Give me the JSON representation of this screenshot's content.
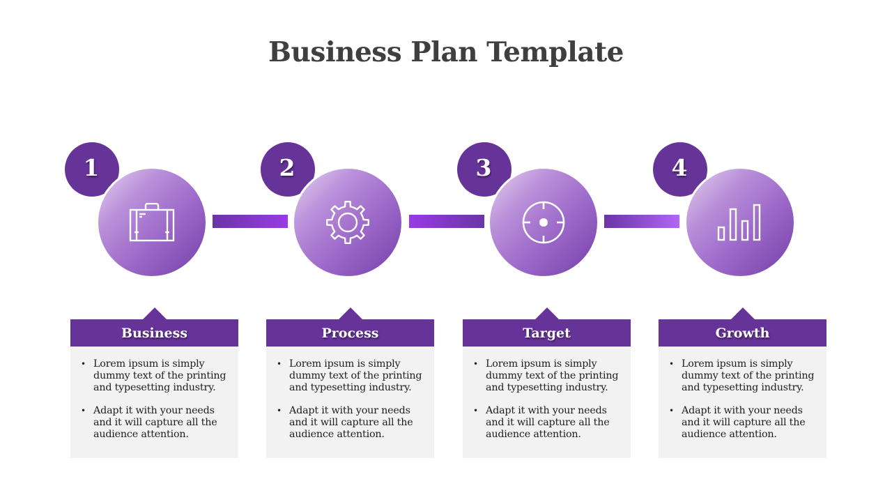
{
  "title": "Business Plan Template",
  "colors": {
    "primary": "#663399",
    "card_bg": "#f2f2f2",
    "title_text": "#3f3f3f"
  },
  "steps": [
    {
      "number": "1",
      "icon": "briefcase-icon",
      "heading": "Business",
      "bullets": [
        "Lorem ipsum is simply dummy text of the printing and typesetting industry.",
        "Adapt it with your needs and it will capture all the audience attention."
      ]
    },
    {
      "number": "2",
      "icon": "gear-icon",
      "heading": "Process",
      "bullets": [
        "Lorem ipsum is simply dummy text of the printing and typesetting industry.",
        "Adapt it with your needs and it will capture all the audience attention."
      ]
    },
    {
      "number": "3",
      "icon": "target-icon",
      "heading": "Target",
      "bullets": [
        "Lorem ipsum is simply dummy text of the printing and typesetting industry.",
        "Adapt it with your needs and it will capture all the audience attention."
      ]
    },
    {
      "number": "4",
      "icon": "bar-chart-icon",
      "heading": "Growth",
      "bullets": [
        "Lorem ipsum is simply dummy text of the printing and typesetting industry.",
        "Adapt it with your needs and it will capture all the audience attention."
      ]
    }
  ]
}
